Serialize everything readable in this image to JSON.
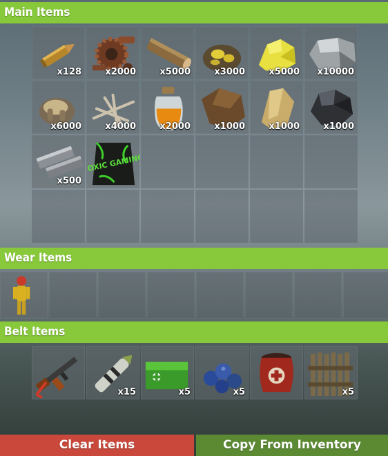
{
  "sections": {
    "main": {
      "title": "Main Items"
    },
    "wear": {
      "title": "Wear Items"
    },
    "belt": {
      "title": "Belt Items"
    }
  },
  "main_items": [
    {
      "name": "rifle-ammo",
      "icon": "bullet-icon",
      "amount": "x128"
    },
    {
      "name": "metal-fragments",
      "icon": "gear-scrap-icon",
      "amount": "x2000"
    },
    {
      "name": "wood",
      "icon": "wood-log-icon",
      "amount": "x5000"
    },
    {
      "name": "sulfur-ore",
      "icon": "sulfur-ore-icon",
      "amount": "x3000"
    },
    {
      "name": "sulfur",
      "icon": "sulfur-icon",
      "amount": "x5000"
    },
    {
      "name": "stones",
      "icon": "stone-icon",
      "amount": "x10000"
    },
    {
      "name": "animal-fat",
      "icon": "fat-icon",
      "amount": "x6000"
    },
    {
      "name": "bone-fragments",
      "icon": "bone-icon",
      "amount": "x4000"
    },
    {
      "name": "low-grade-fuel",
      "icon": "fuel-jar-icon",
      "amount": "x2000"
    },
    {
      "name": "leather",
      "icon": "leather-icon",
      "amount": "x1000"
    },
    {
      "name": "cloth",
      "icon": "cloth-icon",
      "amount": "x1000"
    },
    {
      "name": "charcoal",
      "icon": "charcoal-icon",
      "amount": "x1000"
    },
    {
      "name": "metal-bars",
      "icon": "metal-bars-icon",
      "amount": "x500"
    },
    {
      "name": "toxic-gaming-bag",
      "icon": "toxic-bag-icon",
      "amount": "",
      "logo_text": "TOXIC GAMING"
    }
  ],
  "wear_items": [
    {
      "name": "hazmat-suit",
      "icon": "hazmat-suit-icon",
      "amount": ""
    }
  ],
  "belt_items": [
    {
      "name": "assault-rifle",
      "icon": "rifle-icon",
      "amount": ""
    },
    {
      "name": "rocket",
      "icon": "rocket-icon",
      "amount": "x15"
    },
    {
      "name": "medkit",
      "icon": "medkit-icon",
      "amount": "x5"
    },
    {
      "name": "blueberries",
      "icon": "berries-icon",
      "amount": "x5"
    },
    {
      "name": "explosive-barrel",
      "icon": "barrel-icon",
      "amount": ""
    },
    {
      "name": "wooden-barricade",
      "icon": "barricade-icon",
      "amount": "x5"
    }
  ],
  "buttons": {
    "clear": "Clear Items",
    "copy": "Copy From Inventory"
  }
}
